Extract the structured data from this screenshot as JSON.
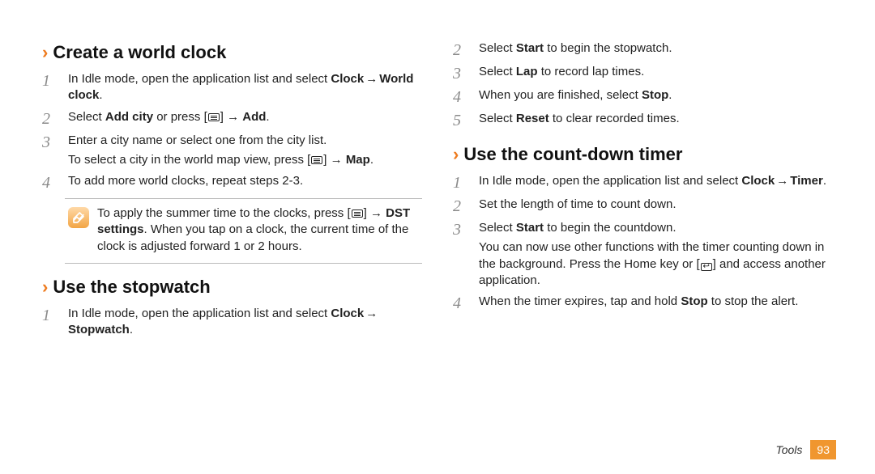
{
  "footer": {
    "section": "Tools",
    "page": "93"
  },
  "left": {
    "section1": {
      "title": "Create a world clock",
      "step1": {
        "pre": "In Idle mode, open the application list and select ",
        "b1": "Clock",
        "arrow": " → ",
        "b2": "World clock",
        "post": "."
      },
      "step2": {
        "pre": "Select ",
        "b1": "Add city",
        "mid": " or press [",
        "arrow": "] → ",
        "b2": "Add",
        "post": "."
      },
      "step3": {
        "line1": "Enter a city name or select one from the city list.",
        "line2_pre": "To select a city in the world map view, press [",
        "line2_arrow": "] → ",
        "line2_b": "Map",
        "line2_post": "."
      },
      "step4": {
        "text": "To add more world clocks, repeat steps 2-3."
      },
      "note": {
        "pre": "To apply the summer time to the clocks, press [",
        "arrow": "] → ",
        "b": "DST settings",
        "post": ". When you tap on a clock, the current time of the clock is adjusted forward 1 or 2 hours."
      }
    },
    "section2": {
      "title": "Use the stopwatch",
      "step1": {
        "pre": "In Idle mode, open the application list and select ",
        "b1": "Clock",
        "arrow": " → ",
        "b2": "Stopwatch",
        "post": "."
      }
    }
  },
  "right": {
    "stopwatch": {
      "step2": {
        "pre": "Select ",
        "b": "Start",
        "post": " to begin the stopwatch."
      },
      "step3": {
        "pre": "Select ",
        "b": "Lap",
        "post": " to record lap times."
      },
      "step4": {
        "pre": "When you are finished, select ",
        "b": "Stop",
        "post": "."
      },
      "step5": {
        "pre": "Select ",
        "b": "Reset",
        "post": " to clear recorded times."
      }
    },
    "section3": {
      "title": "Use the count-down timer",
      "step1": {
        "pre": "In Idle mode, open the application list and select ",
        "b1": "Clock",
        "arrow": " → ",
        "b2": "Timer",
        "post": "."
      },
      "step2": {
        "text": "Set the length of time to count down."
      },
      "step3": {
        "pre": "Select ",
        "b": "Start",
        "post": " to begin the countdown.",
        "sub_pre": "You can now use other functions with the timer counting down in the background. Press the Home key or [",
        "sub_post": "] and access another application."
      },
      "step4": {
        "pre": "When the timer expires, tap and hold ",
        "b": "Stop",
        "post": " to stop the alert."
      }
    }
  },
  "nums": {
    "1": "1",
    "2": "2",
    "3": "3",
    "4": "4",
    "5": "5"
  }
}
